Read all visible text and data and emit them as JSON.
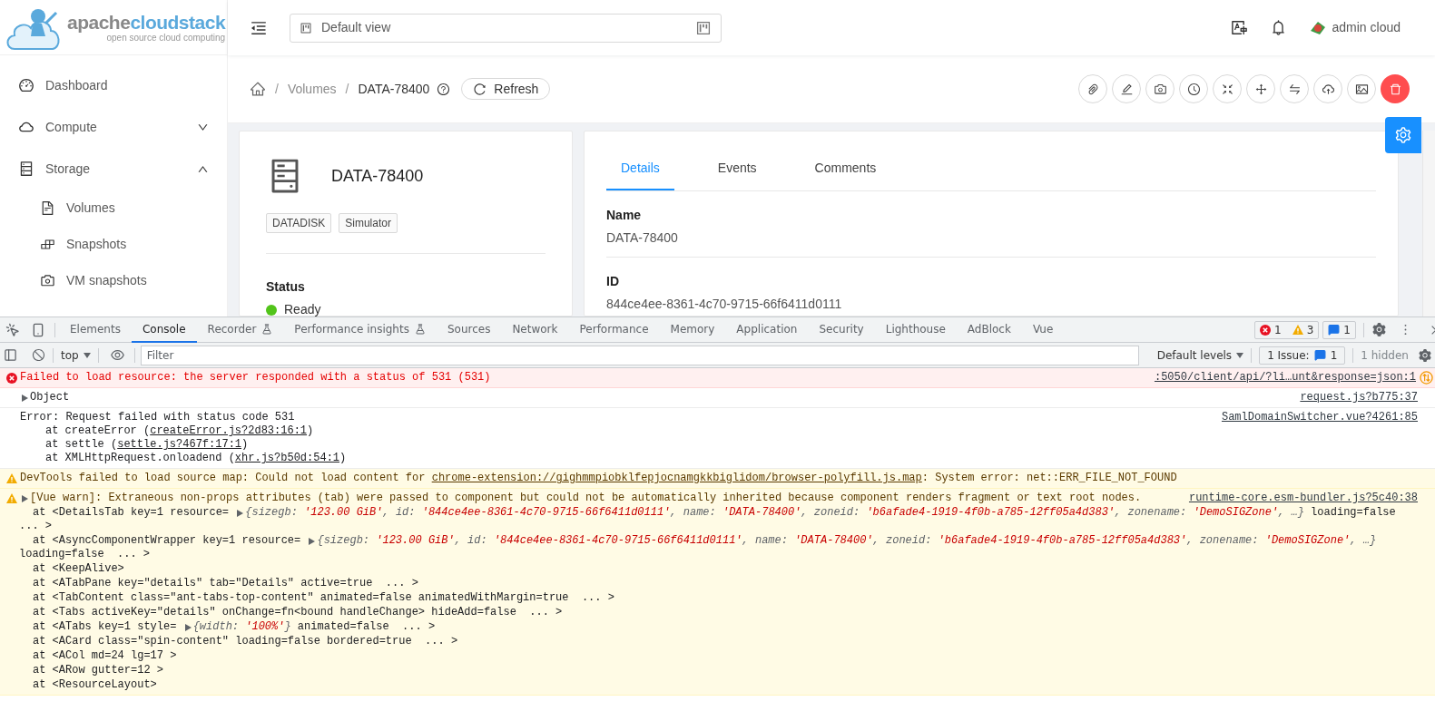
{
  "logo": {
    "word1": "apache",
    "word2": "cloudstack",
    "tagline": "open source cloud computing"
  },
  "header": {
    "view_selector": "Default view",
    "user": "admin cloud"
  },
  "sidebar": {
    "items": [
      {
        "label": "Dashboard",
        "kind": "link"
      },
      {
        "label": "Compute",
        "kind": "group",
        "expanded": false
      },
      {
        "label": "Storage",
        "kind": "group",
        "expanded": true,
        "children": [
          {
            "label": "Volumes"
          },
          {
            "label": "Snapshots"
          },
          {
            "label": "VM snapshots"
          }
        ]
      }
    ]
  },
  "breadcrumb": [
    {
      "separator": "/",
      "label": "Volumes"
    },
    {
      "separator": "/",
      "label": "DATA-78400"
    }
  ],
  "refresh_button": "Refresh",
  "resource": {
    "name": "DATA-78400",
    "tags": [
      "DATADISK",
      "Simulator"
    ],
    "status_label": "Status",
    "status": "Ready"
  },
  "tabs": [
    {
      "label": "Details",
      "selected": true
    },
    {
      "label": "Events",
      "selected": false
    },
    {
      "label": "Comments",
      "selected": false
    }
  ],
  "details": [
    {
      "label": "Name",
      "value": "DATA-78400"
    },
    {
      "label": "ID",
      "value": "844ce4ee-8361-4c70-9715-66f6411d0111"
    }
  ],
  "devtools": {
    "tabs": [
      {
        "label": "Elements",
        "selected": false,
        "experimental": false
      },
      {
        "label": "Console",
        "selected": true,
        "experimental": false
      },
      {
        "label": "Recorder",
        "selected": false,
        "experimental": true
      },
      {
        "label": "Performance insights",
        "selected": false,
        "experimental": true
      },
      {
        "label": "Sources",
        "selected": false,
        "experimental": false
      },
      {
        "label": "Network",
        "selected": false,
        "experimental": false
      },
      {
        "label": "Performance",
        "selected": false,
        "experimental": false
      },
      {
        "label": "Memory",
        "selected": false,
        "experimental": false
      },
      {
        "label": "Application",
        "selected": false,
        "experimental": false
      },
      {
        "label": "Security",
        "selected": false,
        "experimental": false
      },
      {
        "label": "Lighthouse",
        "selected": false,
        "experimental": false
      },
      {
        "label": "AdBlock",
        "selected": false,
        "experimental": false
      },
      {
        "label": "Vue",
        "selected": false,
        "experimental": false
      }
    ],
    "error_count": "1",
    "warning_count": "3",
    "message_count": "1",
    "context": "top",
    "filter_placeholder": "Filter",
    "levels": "Default levels",
    "issues_label": "1 Issue:",
    "issues_count": "1",
    "hidden": "1 hidden",
    "messages": [
      {
        "kind": "error",
        "text": "Failed to load resource: the server responded with a status of 531 (531)",
        "source": ":5050/client/api/?li…unt&response=json:1"
      },
      {
        "kind": "info",
        "expandable": true,
        "text": "Object",
        "source": "request.js?b775:37"
      },
      {
        "kind": "info",
        "text": "Error: Request failed with status code 531",
        "source": "SamlDomainSwitcher.vue?4261:85",
        "stack": [
          {
            "text": "at createError (",
            "link": "createError.js?2d83:16:1",
            "end": ")"
          },
          {
            "text": "at settle (",
            "link": "settle.js?467f:17:1",
            "end": ")"
          },
          {
            "text": "at XMLHttpRequest.onloadend (",
            "link": "xhr.js?b50d:54:1",
            "end": ")"
          }
        ]
      },
      {
        "kind": "warning",
        "text": "DevTools failed to load source map: Could not load content for ",
        "link": "chrome-extension://gighmmpiobklfepjocnamgkkbiglidom/browser-polyfill.js.map",
        "end": ": System error: net::ERR_FILE_NOT_FOUND"
      },
      {
        "kind": "warning",
        "expandable": true,
        "text": "[Vue warn]: Extraneous non-props attributes (tab) were passed to component but could not be automatically inherited because component renders fragment or text root nodes.",
        "source": "runtime-core.esm-bundler.js?5c40:38",
        "frames": [
          {
            "text": "at <DetailsTab key=1 resource= ",
            "preview": {
              "entries": [
                {
                  "key": "{sizegb: ",
                  "value": "'123.00 GiB'"
                },
                {
                  "key": ", id: ",
                  "value": "'844ce4ee-8361-4c70-9715-66f6411d0111'"
                },
                {
                  "key": ", name: ",
                  "value": "'DATA-78400'"
                },
                {
                  "key": ", zoneid: ",
                  "value": "'b6afade4-1919-4f0b-a785-12ff05a4d383'"
                },
                {
                  "key": ", zonename: ",
                  "value": "'DemoSIGZone'"
                }
              ],
              "tail": ", …}"
            },
            "after": " loading=false",
            "wrapped": "... >"
          },
          {
            "text": "at <AsyncComponentWrapper key=1 resource= ",
            "preview": {
              "entries": [
                {
                  "key": "{sizegb: ",
                  "value": "'123.00 GiB'"
                },
                {
                  "key": ", id: ",
                  "value": "'844ce4ee-8361-4c70-9715-66f6411d0111'"
                },
                {
                  "key": ", name: ",
                  "value": "'DATA-78400'"
                },
                {
                  "key": ", zoneid: ",
                  "value": "'b6afade4-1919-4f0b-a785-12ff05a4d383'"
                },
                {
                  "key": ", zonename: ",
                  "value": "'DemoSIGZone'"
                }
              ],
              "tail": ", …}"
            },
            "wrapped": "loading=false  ... >"
          },
          {
            "text": "at <KeepAlive>"
          },
          {
            "text": "at <ATabPane key=\"details\" tab=\"Details\" active=true  ... >"
          },
          {
            "text": "at <TabContent class=\"ant-tabs-top-content\" animated=false animatedWithMargin=true  ... >"
          },
          {
            "text": "at <Tabs activeKey=\"details\" onChange=fn<bound handleChange> hideAdd=false  ... >"
          },
          {
            "text": "at <ATabs key=1 style= ",
            "preview": {
              "entries": [
                {
                  "key": "{width: ",
                  "value": "'100%'"
                }
              ],
              "tail": "}"
            },
            "after": " animated=false  ... >"
          },
          {
            "text": "at <ACard class=\"spin-content\" loading=false bordered=true  ... >"
          },
          {
            "text": "at <ACol md=24 lg=17 >"
          },
          {
            "text": "at <ARow gutter=12 >"
          },
          {
            "text": "at <ResourceLayout>"
          }
        ]
      }
    ]
  }
}
